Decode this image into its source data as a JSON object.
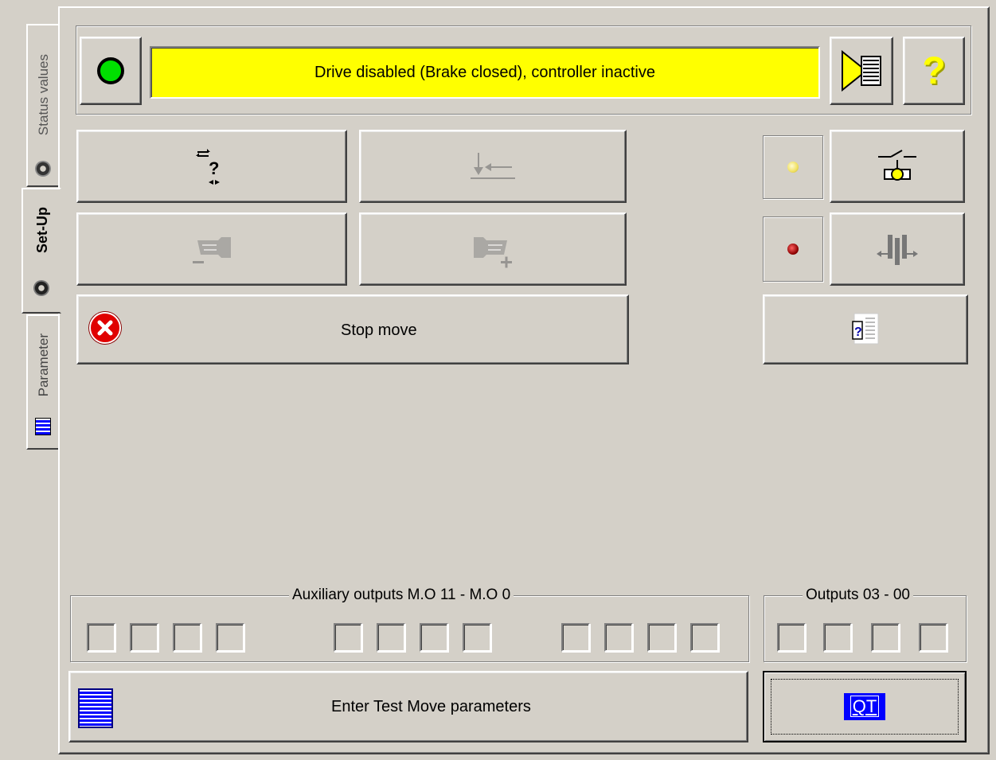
{
  "tabs": [
    {
      "label": "Status values",
      "icon": "gear-icon",
      "active": false
    },
    {
      "label": "Set-Up",
      "icon": "gear-icon",
      "active": true
    },
    {
      "label": "Parameter",
      "icon": "list-icon",
      "active": false
    }
  ],
  "status": {
    "indicator": "green-led-icon",
    "text": "Drive disabled (Brake closed), controller inactive",
    "background": "#ffff00",
    "help_glyph": "?"
  },
  "buttons": {
    "reference_glyph": "?",
    "stop_label": "Stop move",
    "test_move_label": "Enter Test Move parameters",
    "qt_label": "QT"
  },
  "leds": {
    "brake": "#f0e060",
    "enable": "#8b0000"
  },
  "aux_outputs": {
    "title": "Auxiliary outputs M.O 11 - M.O 0",
    "count": 12
  },
  "outputs": {
    "title": "Outputs 03 - 00",
    "count": 4
  },
  "colors": {
    "face": "#d4d0c8",
    "accent_blue": "#0000ff",
    "stop_red": "#e00000"
  }
}
